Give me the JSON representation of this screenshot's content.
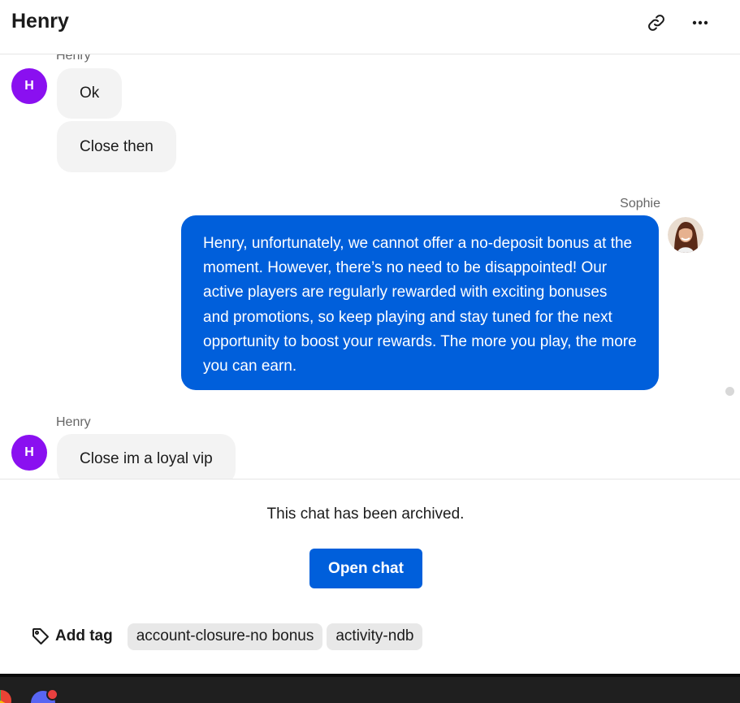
{
  "header": {
    "title": "Henry",
    "link_icon": "link-icon",
    "more_icon": "more-horizontal-icon"
  },
  "messages": {
    "group1": {
      "sender": "Henry",
      "avatar_initial": "H",
      "bubbles": [
        "Ok",
        "Close then"
      ]
    },
    "group2": {
      "sender": "Sophie",
      "text": "Henry, unfortunately, we cannot offer a no-deposit bonus at the moment. However, there’s no need to be disappointed! Our active players are regularly rewarded with exciting bonuses and promotions, so keep playing and stay tuned for the next opportunity to boost your rewards. The more you play, the more you can earn."
    },
    "group3": {
      "sender": "Henry",
      "avatar_initial": "H",
      "bubbles": [
        "Close im a loyal vip"
      ]
    }
  },
  "footer": {
    "archived_text": "This chat has been archived.",
    "open_chat_label": "Open chat",
    "add_tag_label": "Add tag",
    "tags": [
      "account-closure-no bonus",
      "activity-ndb"
    ]
  },
  "colors": {
    "accent": "#005fdb",
    "avatar_purple": "#8a10f0",
    "incoming_bubble": "#f3f3f3",
    "tag_chip": "#e8e8e8"
  }
}
